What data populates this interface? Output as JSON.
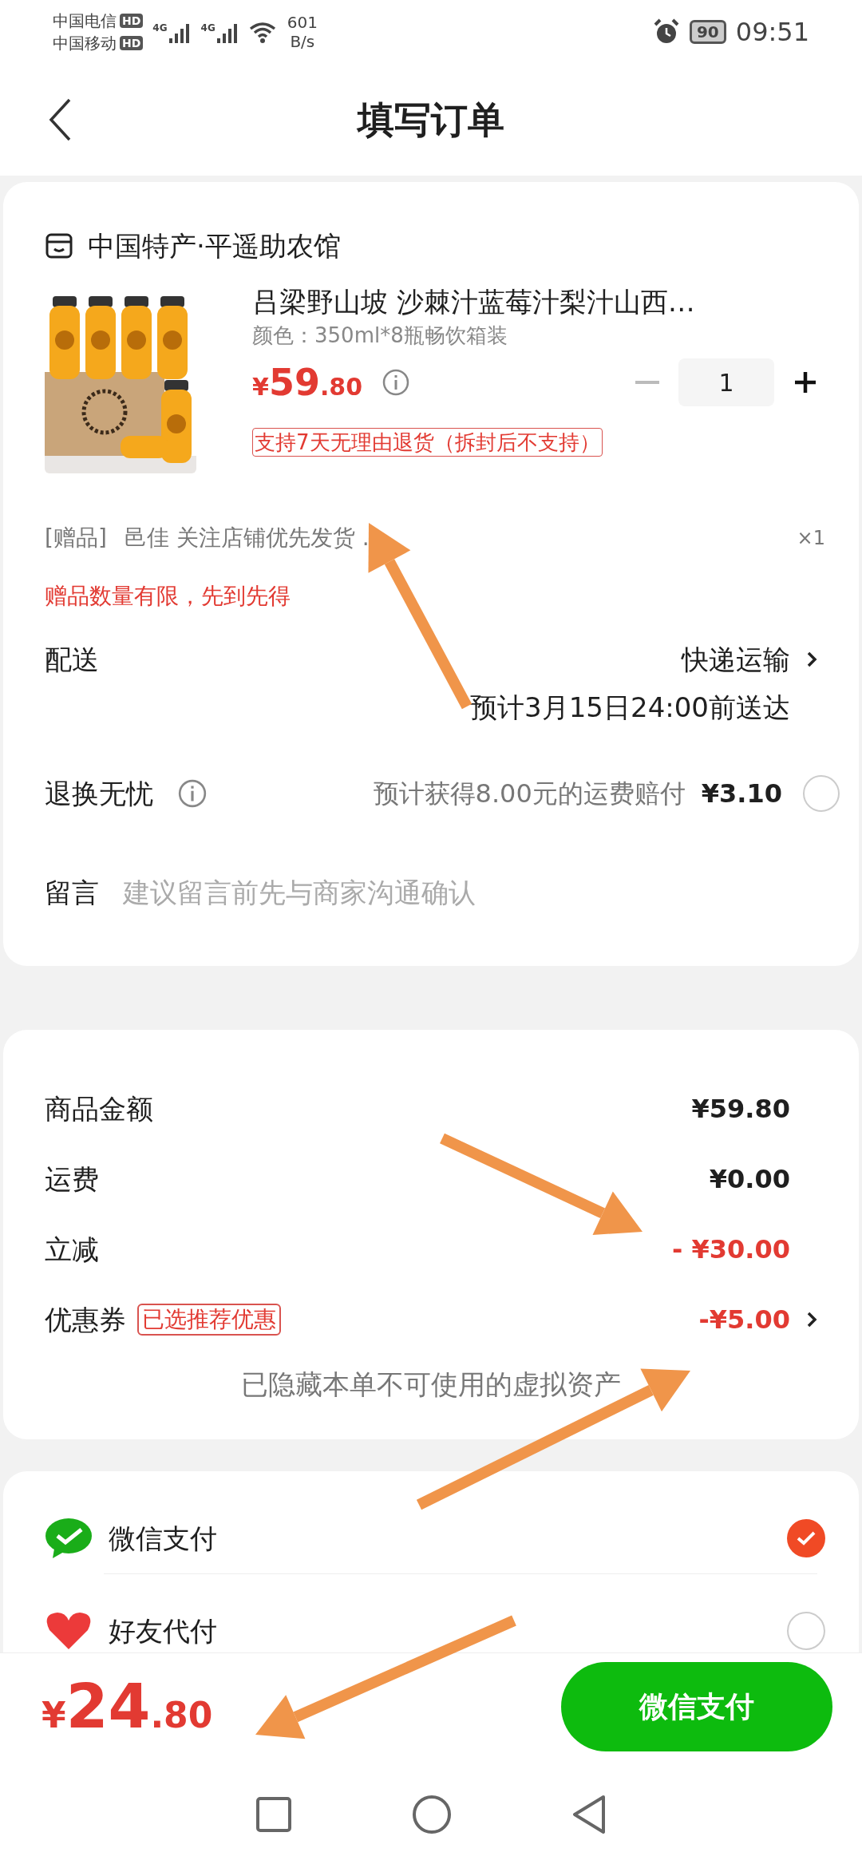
{
  "status_bar": {
    "carriers": [
      {
        "name": "中国电信",
        "badge": "HD"
      },
      {
        "name": "中国移动",
        "badge": "HD"
      }
    ],
    "signals": [
      "4G",
      "4G"
    ],
    "speed": "601",
    "speed_unit": "B/s",
    "battery": "90",
    "time": "09:51"
  },
  "header": {
    "title": "填写订单"
  },
  "order": {
    "shop": "中国特产·平遥助农馆",
    "product": {
      "kind": "picture",
      "title": "吕梁野山坡 沙棘汁蓝莓汁梨汁山西…",
      "variant": "颜色：350ml*8瓶畅饮箱装",
      "price": {
        "currency": "¥",
        "integer": "59",
        "decimal": ".80"
      },
      "quantity": "1",
      "return_badge": "支持7天无理由退货（拆封后不支持）"
    },
    "gift": {
      "tag": "[赠品]",
      "name": "邑佳 关注店铺优先发货 .",
      "count": "×1",
      "notice": "赠品数量有限，先到先得"
    },
    "delivery": {
      "label": "配送",
      "method": "快递运输",
      "eta": "预计3月15日24:00前送达"
    },
    "insurance": {
      "label": "退换无忧",
      "text": "预计获得8.00元的运费赔付",
      "price": "¥3.10",
      "checked": false
    },
    "message": {
      "label": "留言",
      "placeholder": "建议留言前先与商家沟通确认"
    }
  },
  "summary": {
    "rows": [
      {
        "label": "商品金额",
        "value": "¥59.80",
        "kind": "plain"
      },
      {
        "label": "运费",
        "value": "¥0.00",
        "kind": "plain"
      },
      {
        "label": "立减",
        "value": "- ¥30.00",
        "kind": "discount"
      },
      {
        "label": "优惠券",
        "tag": "已选推荐优惠",
        "value": "-¥5.00",
        "kind": "coupon"
      }
    ],
    "note": "已隐藏本单不可使用的虚拟资产"
  },
  "payment": {
    "methods": [
      {
        "name": "微信支付",
        "kind": "wechat",
        "selected": true
      },
      {
        "name": "好友代付",
        "kind": "friend",
        "selected": false
      }
    ]
  },
  "bottom_bar": {
    "total": {
      "currency": "¥",
      "integer": "24",
      "decimal": ".80"
    },
    "pay_button": "微信支付"
  }
}
